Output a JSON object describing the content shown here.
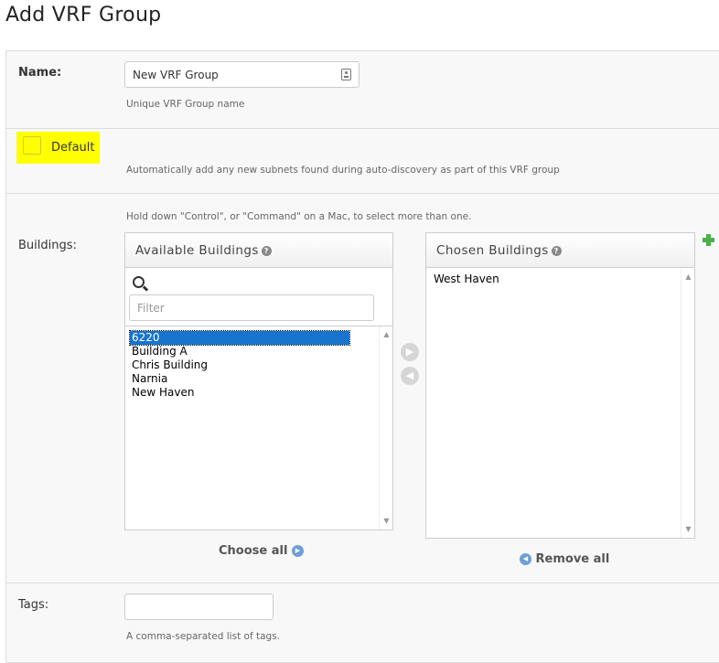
{
  "page": {
    "title": "Add VRF Group"
  },
  "name_field": {
    "label": "Name:",
    "value": "New VRF Group",
    "help": "Unique VRF Group name"
  },
  "default_field": {
    "label": "Default",
    "checked": false,
    "help": "Automatically add any new subnets found during auto-discovery as part of this VRF group"
  },
  "buildings_field": {
    "label": "Buildings:",
    "help": "Hold down \"Control\", or \"Command\" on a Mac, to select more than one.",
    "available": {
      "title": "Available Buildings",
      "filter_placeholder": "Filter",
      "options": [
        "6220",
        "Building A",
        "Chris Building",
        "Narnia",
        "New Haven"
      ],
      "selected_option": "6220",
      "choose_all_label": "Choose all"
    },
    "chosen": {
      "title": "Chosen Buildings",
      "options": [
        "West Haven"
      ],
      "remove_all_label": "Remove all"
    },
    "move_right_icon": "arrow-right-circle-icon",
    "move_left_icon": "arrow-left-circle-icon",
    "add_icon": "plus-icon"
  },
  "tags_field": {
    "label": "Tags:",
    "value": "",
    "help": "A comma-separated list of tags."
  },
  "colors": {
    "highlight": "#ffff00",
    "link_blue": "#6f9fd4",
    "selection_blue": "#1874cd",
    "add_green": "#4cae4c"
  }
}
